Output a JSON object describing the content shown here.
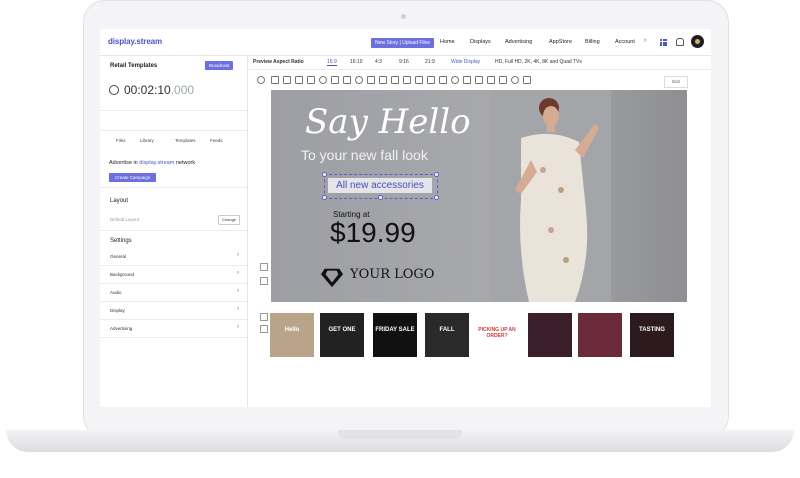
{
  "app": {
    "logo": "display.stream",
    "new_story_label": "New Story | Upload Files",
    "nav": [
      "Home",
      "Displays",
      "Advertising",
      "AppStore",
      "Billing",
      "Account"
    ]
  },
  "left_panel": {
    "title": "Retail Templates",
    "broadcast_label": "Broadcast",
    "timer_main": "00:02:10",
    "timer_ms": ".000",
    "tabs": [
      "Files",
      "Library",
      "Templates",
      "Feeds"
    ],
    "advertise_prefix": "Advertise in ",
    "advertise_brand": "display.stream",
    "advertise_suffix": " network",
    "create_campaign_label": "Create Campaign",
    "layout_title": "Layout",
    "layout_value": "Default Layout",
    "change_label": "Change",
    "settings_title": "Settings",
    "settings_items": [
      "General",
      "Background",
      "Audio",
      "Display",
      "Advertising"
    ]
  },
  "aspect": {
    "label": "Preview Aspect Ratio",
    "options": [
      "16:9",
      "16:10",
      "4:3",
      "9:16",
      "21:9",
      "Wide Display"
    ],
    "selected": "16:9",
    "note": "HD, Full HD, 2K, 4K, 8K and Quad TVs"
  },
  "toolbar": {
    "exit_label": "Exit"
  },
  "canvas": {
    "headline": "Say Hello",
    "subline": "To your new fall look",
    "selected_text": "All new accessories",
    "starting_label": "Starting at",
    "price": "$19.99",
    "logo_text": "YOUR LOGO"
  },
  "thumbnails": [
    {
      "name": "thumb-hello",
      "text": "Hello",
      "bg": "#b9a48a"
    },
    {
      "name": "thumb-get-one",
      "text": "GET ONE",
      "bg": "#222222"
    },
    {
      "name": "thumb-friday-sale",
      "text": "FRIDAY SALE",
      "bg": "#111111"
    },
    {
      "name": "thumb-fall",
      "text": "FALL",
      "bg": "#2a2a2a"
    },
    {
      "name": "thumb-pickup",
      "text": "PICKING UP AN ORDER?",
      "bg": "#ffffff"
    },
    {
      "name": "thumb-wine",
      "text": "",
      "bg": "#3b1f2a"
    },
    {
      "name": "thumb-sale",
      "text": "",
      "bg": "#6a2a3a"
    },
    {
      "name": "thumb-tasting",
      "text": "TASTING",
      "bg": "#2d1a1e"
    },
    {
      "name": "thumb-last",
      "text": "",
      "bg": "#3a3030"
    }
  ]
}
